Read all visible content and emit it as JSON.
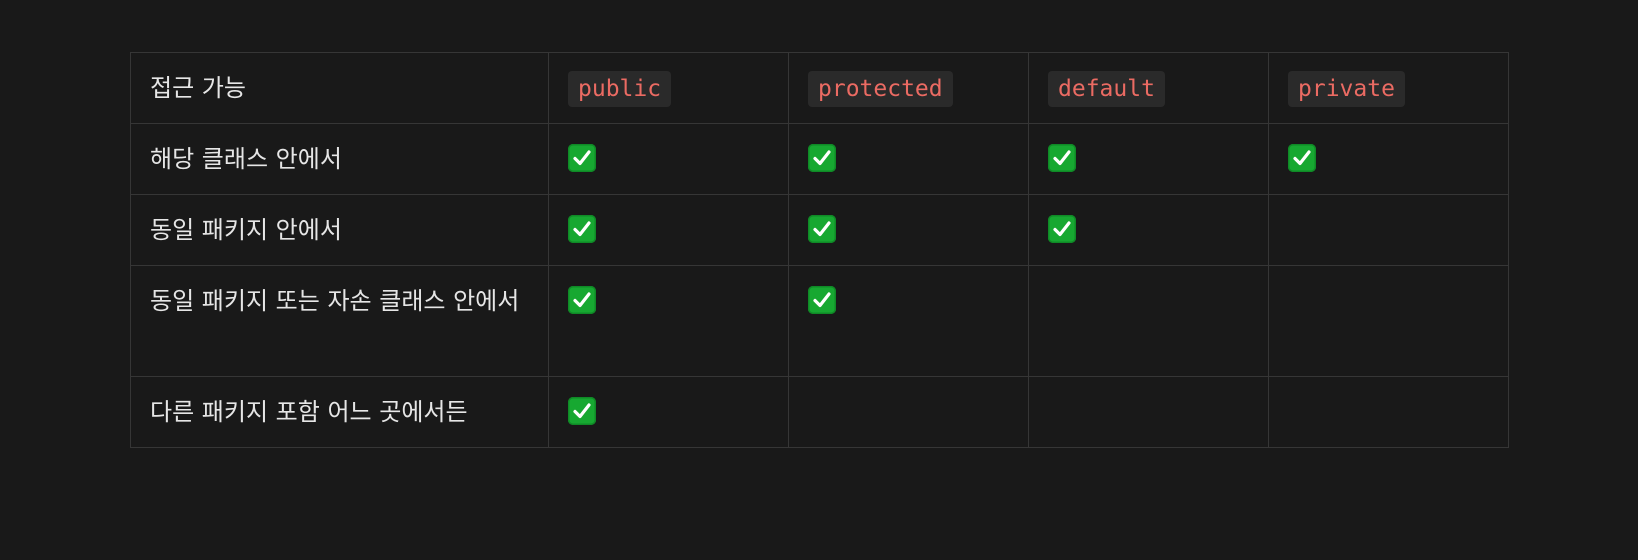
{
  "table": {
    "header": {
      "label": "접근 가능",
      "columns": [
        "public",
        "protected",
        "default",
        "private"
      ]
    },
    "rows": [
      {
        "label": "해당 클래스 안에서",
        "checks": [
          true,
          true,
          true,
          true
        ]
      },
      {
        "label": "동일 패키지 안에서",
        "checks": [
          true,
          true,
          true,
          false
        ]
      },
      {
        "label": "동일 패키지 또는 자손 클래스 안에서",
        "checks": [
          true,
          true,
          false,
          false
        ]
      },
      {
        "label": "다른 패키지 포함 어느 곳에서든",
        "checks": [
          true,
          false,
          false,
          false
        ]
      }
    ],
    "check_icon": "check-mark-button-icon",
    "colors": {
      "background": "#191919",
      "border": "#363636",
      "code_text": "#eb6b63",
      "code_background": "#2a2a2a",
      "check_green": "#17a831"
    }
  }
}
